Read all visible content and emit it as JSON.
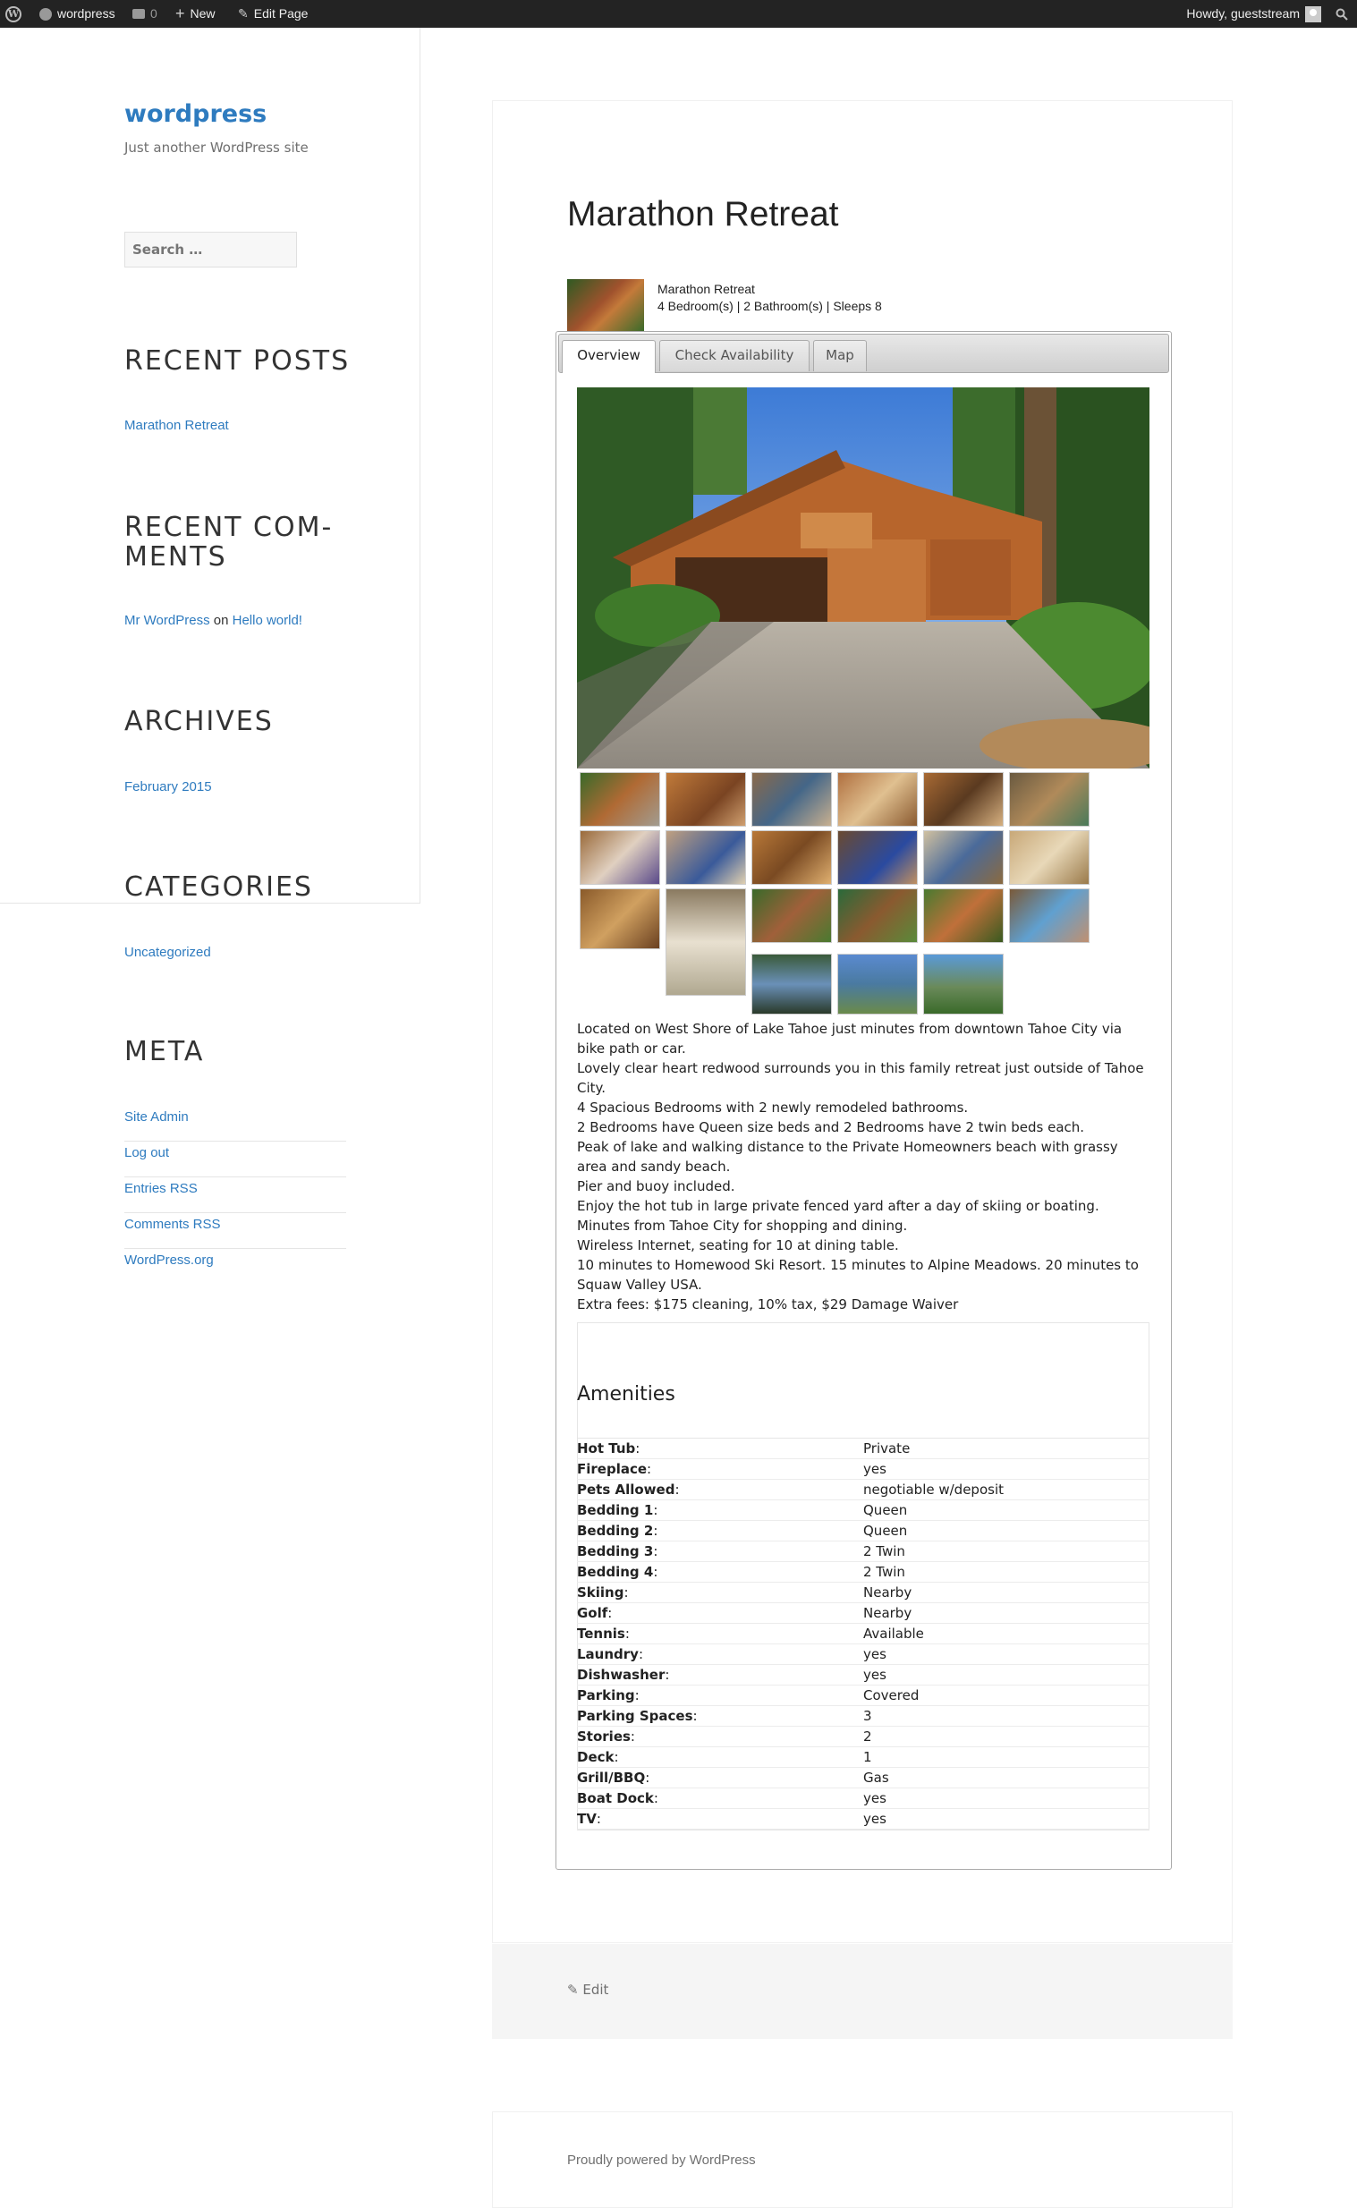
{
  "admin_bar": {
    "site_name": "wordpress",
    "comments_count": "0",
    "new_label": "New",
    "edit_label": "Edit Page",
    "howdy": "Howdy, gueststream"
  },
  "site": {
    "title": "wordpress",
    "description": "Just another WordPress site"
  },
  "search": {
    "placeholder": "Search …"
  },
  "widgets": {
    "recent_posts": {
      "title": "RECENT POSTS",
      "items": [
        "Marathon Retreat"
      ]
    },
    "recent_comments": {
      "title_line1": "RECENT COM-",
      "title_line2": "MENTS",
      "author": "Mr WordPress",
      "on": "on",
      "post": "Hello world!"
    },
    "archives": {
      "title": "ARCHIVES",
      "items": [
        "February 2015"
      ]
    },
    "categories": {
      "title": "CATEGORIES",
      "items": [
        "Uncategorized"
      ]
    },
    "meta": {
      "title": "META",
      "items": [
        "Site Admin",
        "Log out",
        "Entries RSS",
        "Comments RSS",
        "WordPress.org"
      ]
    }
  },
  "article": {
    "title": "Marathon Retreat",
    "summary_name": "Marathon Retreat",
    "summary_info": "4 Bedroom(s) | 2 Bathroom(s) | Sleeps 8",
    "tabs": [
      "Overview",
      "Check Availability",
      "Map"
    ],
    "description": [
      "Located on West Shore of Lake Tahoe just minutes from downtown Tahoe City via bike path or car.",
      "Lovely clear heart redwood surrounds you in this family retreat just outside of Tahoe City.",
      "4 Spacious Bedrooms with 2 newly remodeled bathrooms.",
      "2 Bedrooms have Queen size beds and 2 Bedrooms have 2 twin beds each.",
      "Peak of lake and walking distance to the Private Homeowners beach with grassy area and sandy beach.",
      "Pier and buoy included.",
      "Enjoy the hot tub in large private fenced yard after a day of skiing or boating.",
      "Minutes from Tahoe City for shopping and dining.",
      "Wireless Internet, seating for 10 at dining table.",
      "10 minutes to Homewood Ski Resort. 15 minutes to Alpine Meadows. 20 minutes to Squaw Valley USA.",
      "Extra fees: $175 cleaning, 10% tax, $29 Damage Waiver"
    ],
    "amenities_title": "Amenities",
    "amenities": [
      {
        "key": "Hot Tub",
        "value": "Private"
      },
      {
        "key": "Fireplace",
        "value": "yes"
      },
      {
        "key": "Pets Allowed",
        "value": "negotiable w/deposit"
      },
      {
        "key": "Bedding 1",
        "value": "Queen"
      },
      {
        "key": "Bedding 2",
        "value": "Queen"
      },
      {
        "key": "Bedding 3",
        "value": "2 Twin"
      },
      {
        "key": "Bedding 4",
        "value": "2 Twin"
      },
      {
        "key": "Skiing",
        "value": "Nearby"
      },
      {
        "key": "Golf",
        "value": "Nearby"
      },
      {
        "key": "Tennis",
        "value": "Available"
      },
      {
        "key": "Laundry",
        "value": "yes"
      },
      {
        "key": "Dishwasher",
        "value": "yes"
      },
      {
        "key": "Parking",
        "value": "Covered"
      },
      {
        "key": "Parking Spaces",
        "value": "3"
      },
      {
        "key": "Stories",
        "value": "2"
      },
      {
        "key": "Deck",
        "value": "1"
      },
      {
        "key": "Grill/BBQ",
        "value": "Gas"
      },
      {
        "key": "Boat Dock",
        "value": "yes"
      },
      {
        "key": "TV",
        "value": "yes"
      }
    ],
    "edit_label": "Edit"
  },
  "footer": {
    "text": "Proudly powered by WordPress"
  },
  "colors": {
    "link": "#2e7bbf",
    "admin_bar": "#232323"
  }
}
